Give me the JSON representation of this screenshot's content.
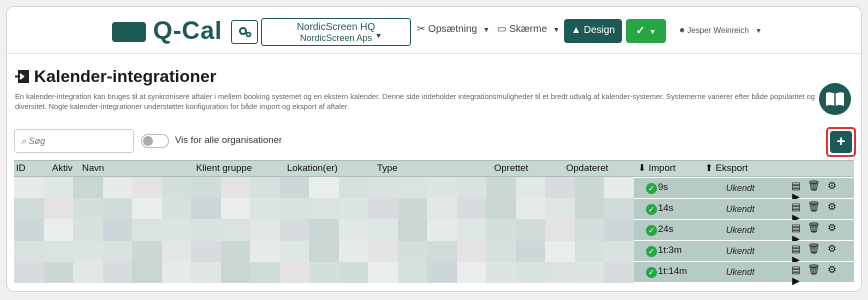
{
  "header": {
    "logo_text": "Q-Cal",
    "org_icon": "cogs-icon",
    "org_name": "NordicScreen HQ",
    "org_sub": "NordicScreen Aps",
    "nav": [
      {
        "label": "Opsætning",
        "icon": "tools-icon"
      },
      {
        "label": "Skærme",
        "icon": "monitor-icon"
      }
    ],
    "design_label": "Design",
    "sync_icon": "sync-check-icon",
    "user_name": "Jesper Weinreich"
  },
  "page": {
    "title": "Kalender-integrationer",
    "description": "En kalender-integration kan bruges til at synkronisere aftaler i mellem booking systemet og en ekstern kalender. Denne side indeholder integrationsmuligheder til et bredt udvalg af kalender-systemer. Systemerne varierer efter både popularitet og diversitet. Nogle kalender-integrationer understøtter konfiguration for både import og eksport af aftaler."
  },
  "toolbar": {
    "search_placeholder": "Søg",
    "toggle_label": "Vis for alle organisationer",
    "add_label": "+"
  },
  "table": {
    "columns": [
      "ID",
      "Aktiv",
      "Navn",
      "Klient gruppe",
      "Lokation(er)",
      "Type",
      "Oprettet",
      "Opdateret",
      "Import",
      "Eksport"
    ],
    "rows": [
      {
        "import": "9s",
        "export": "Ukendt"
      },
      {
        "import": "14s",
        "export": "Ukendt"
      },
      {
        "import": "24s",
        "export": "Ukendt"
      },
      {
        "import": "1t:3m",
        "export": "Ukendt"
      },
      {
        "import": "1t:14m",
        "export": "Ukendt"
      }
    ]
  },
  "colors": {
    "brand": "#1e5a55",
    "success": "#25a641",
    "header_row": "#c7d7d3",
    "row_cell": "#b6cbc6",
    "highlight_border": "#dd3333"
  }
}
